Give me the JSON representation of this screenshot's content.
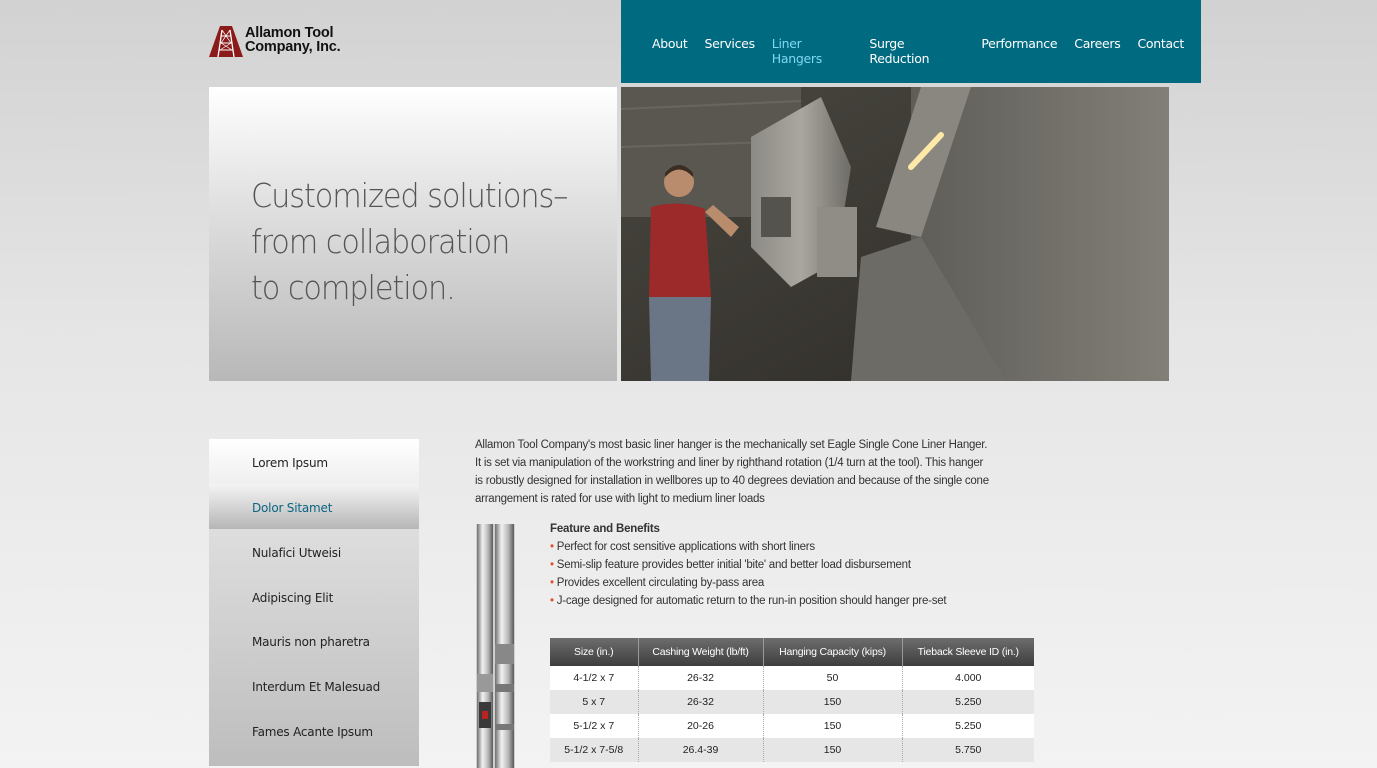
{
  "logo": {
    "line1": "Allamon Tool",
    "line2": "Company, Inc.",
    "icon": "oil-derrick-icon",
    "brand_color": "#8b1a1a"
  },
  "nav": {
    "items": [
      {
        "label": "About"
      },
      {
        "label": "Services"
      },
      {
        "label": "Liner Hangers"
      },
      {
        "label": "Surge Reduction"
      },
      {
        "label": "Performance"
      },
      {
        "label": "Careers"
      },
      {
        "label": "Contact"
      }
    ],
    "active_index": 2,
    "background": "#006a80",
    "active_color": "#7fd8f2"
  },
  "hero": {
    "tagline_lines": [
      "Customized solutions–",
      "from collaboration",
      "to completion."
    ]
  },
  "sidebar": {
    "items": [
      {
        "label": "Lorem Ipsum"
      },
      {
        "label": "Dolor Sitamet"
      },
      {
        "label": "Nulafici Utweisi"
      },
      {
        "label": "Adipiscing Elit"
      },
      {
        "label": "Mauris non pharetra"
      },
      {
        "label": "Interdum Et Malesuad"
      },
      {
        "label": "Fames Acante Ipsum"
      }
    ],
    "active_index": 1
  },
  "content": {
    "intro_lines": [
      "Allamon Tool Company's most basic liner hanger is the mechanically set Eagle Single Cone Liner Hanger.",
      "It is set via manipulation of the workstring and liner by righthand rotation (1/4 turn at the tool). This hanger",
      "is robustly designed for installation in wellbores up to 40 degrees deviation and because of the single cone",
      "arrangement is rated for use with light to medium liner loads"
    ],
    "features_title": "Feature and Benefits",
    "features": [
      "Perfect for cost sensitive applications with short liners",
      "Semi-slip feature provides better initial 'bite' and better load disbursement",
      "Provides excellent circulating by-pass area",
      "J-cage designed for automatic return to the run-in position should hanger pre-set"
    ],
    "bullet_color": "#e0502a",
    "table": {
      "headers": [
        "Size (in.)",
        "Cashing Weight (lb/ft)",
        "Hanging Capacity (kips)",
        "Tieback Sleeve ID (in.)"
      ],
      "rows": [
        [
          "4-1/2 x 7",
          "26-32",
          "50",
          "4.000"
        ],
        [
          "5 x 7",
          "26-32",
          "150",
          "5.250"
        ],
        [
          "5-1/2 x 7",
          "20-26",
          "150",
          "5.250"
        ],
        [
          "5-1/2 x 7-5/8",
          "26.4-39",
          "150",
          "5.750"
        ]
      ]
    }
  }
}
